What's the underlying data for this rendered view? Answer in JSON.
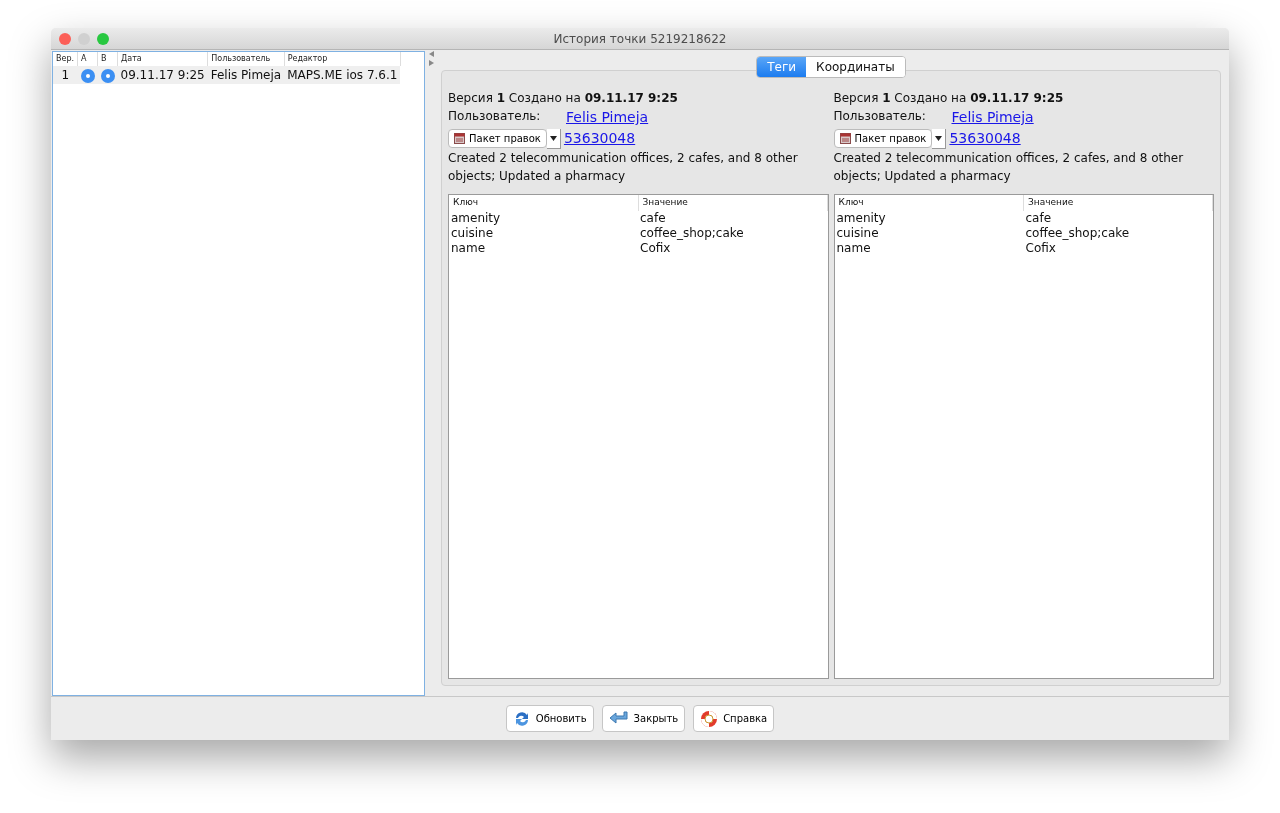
{
  "window": {
    "title": "История точки 5219218622"
  },
  "history_table": {
    "columns": [
      "Вер.",
      "A",
      "B",
      "Дата",
      "Пользователь",
      "Редактор"
    ],
    "rows": [
      {
        "version": "1",
        "a_selected": true,
        "b_selected": true,
        "date": "09.11.17 9:25",
        "user": "Felis Pimeja",
        "editor": "MAPS.ME ios 7.6.1"
      }
    ]
  },
  "tabs": [
    {
      "label": "Теги",
      "selected": true
    },
    {
      "label": "Координаты",
      "selected": false
    }
  ],
  "panels": [
    {
      "version_line": "Версия **1** Создано на **09.11.17 9:25**",
      "user_label": "Пользователь:",
      "user_link": "Felis Pimeja",
      "changeset_button": "Пакет правок",
      "changeset_link": "53630048",
      "comment": "Created 2 telecommunication offices, 2 cafes, and 8 other objects; Updated a pharmacy",
      "columns": [
        "Ключ",
        "Значение"
      ],
      "rows": [
        [
          "amenity",
          "cafe"
        ],
        [
          "cuisine",
          "coffee_shop;cake"
        ],
        [
          "name",
          "Cofix"
        ]
      ]
    },
    {
      "version_line": "Версия **1** Создано на **09.11.17 9:25**",
      "user_label": "Пользователь:",
      "user_link": "Felis Pimeja",
      "changeset_button": "Пакет правок",
      "changeset_link": "53630048",
      "comment": "Created 2 telecommunication offices, 2 cafes, and 8 other objects; Updated a pharmacy",
      "columns": [
        "Ключ",
        "Значение"
      ],
      "rows": [
        [
          "amenity",
          "cafe"
        ],
        [
          "cuisine",
          "coffee_shop;cake"
        ],
        [
          "name",
          "Cofix"
        ]
      ]
    }
  ],
  "buttons": [
    {
      "kind": "refresh",
      "label": "Обновить"
    },
    {
      "kind": "close",
      "label": "Закрыть"
    },
    {
      "kind": "help",
      "label": "Справка"
    }
  ]
}
